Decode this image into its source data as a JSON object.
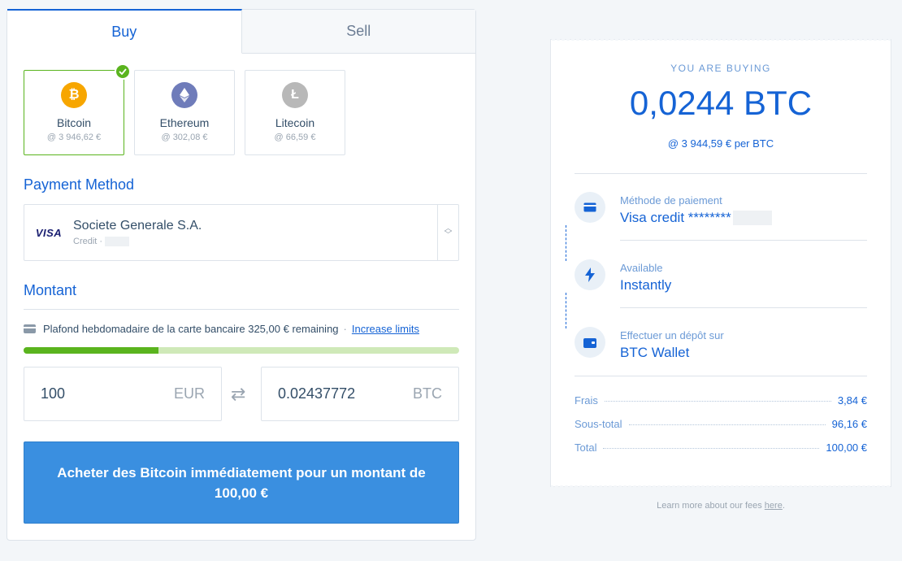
{
  "tabs": {
    "buy": "Buy",
    "sell": "Sell"
  },
  "coins": [
    {
      "name": "Bitcoin",
      "price": "@ 3 946,62 €",
      "symbol": "₿",
      "color": "#f7a600",
      "selected": true
    },
    {
      "name": "Ethereum",
      "price": "@ 302,08 €",
      "symbol": "◆",
      "color": "#6f7cba",
      "selected": false
    },
    {
      "name": "Litecoin",
      "price": "@ 66,59 €",
      "symbol": "Ł",
      "color": "#b8b8b8",
      "selected": false
    }
  ],
  "payment": {
    "title": "Payment Method",
    "brand": "VISA",
    "bank": "Societe Generale S.A.",
    "type": "Credit ·"
  },
  "montant": {
    "title": "Montant",
    "limit_text": "Plafond hebdomadaire de la carte bancaire 325,00 € remaining",
    "limit_link": "Increase limits",
    "progress_fraction": 0.31,
    "fiat_value": "100",
    "fiat_currency": "EUR",
    "crypto_value": "0.02437772",
    "crypto_currency": "BTC"
  },
  "cta_label": "Acheter des Bitcoin immédiatement pour un montant de 100,00 €",
  "receipt": {
    "label": "YOU ARE BUYING",
    "amount": "0,0244 BTC",
    "rate": "@ 3 944,59 € per BTC",
    "items": [
      {
        "label": "Méthode de paiement",
        "value": "Visa credit ********",
        "icon": "card-icon"
      },
      {
        "label": "Available",
        "value": "Instantly",
        "icon": "lightning-icon"
      },
      {
        "label": "Effectuer un dépôt sur",
        "value": "BTC Wallet",
        "icon": "wallet-icon"
      }
    ],
    "fees": [
      {
        "label": "Frais",
        "value": "3,84 €"
      },
      {
        "label": "Sous-total",
        "value": "96,16 €"
      },
      {
        "label": "Total",
        "value": "100,00 €"
      }
    ]
  },
  "learn": {
    "text": "Learn more about our fees ",
    "link": "here",
    "end": "."
  },
  "colors": {
    "accent": "#1563d5",
    "success": "#5ab41e",
    "cta": "#3a8fe0"
  }
}
